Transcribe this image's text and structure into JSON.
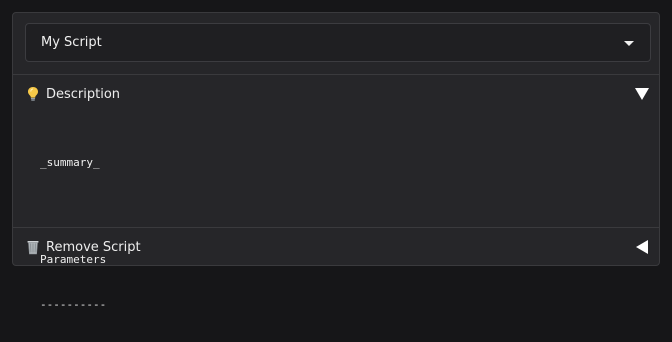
{
  "script_select": {
    "value": "My Script"
  },
  "description_section": {
    "icon": "lightbulb-icon",
    "title": "Description",
    "expanded": true,
    "doc_lines": [
      "_summary_",
      "Parameters",
      "----------"
    ]
  },
  "remove_section": {
    "icon": "wastebasket-icon",
    "title": "Remove Script",
    "expanded": false
  }
}
